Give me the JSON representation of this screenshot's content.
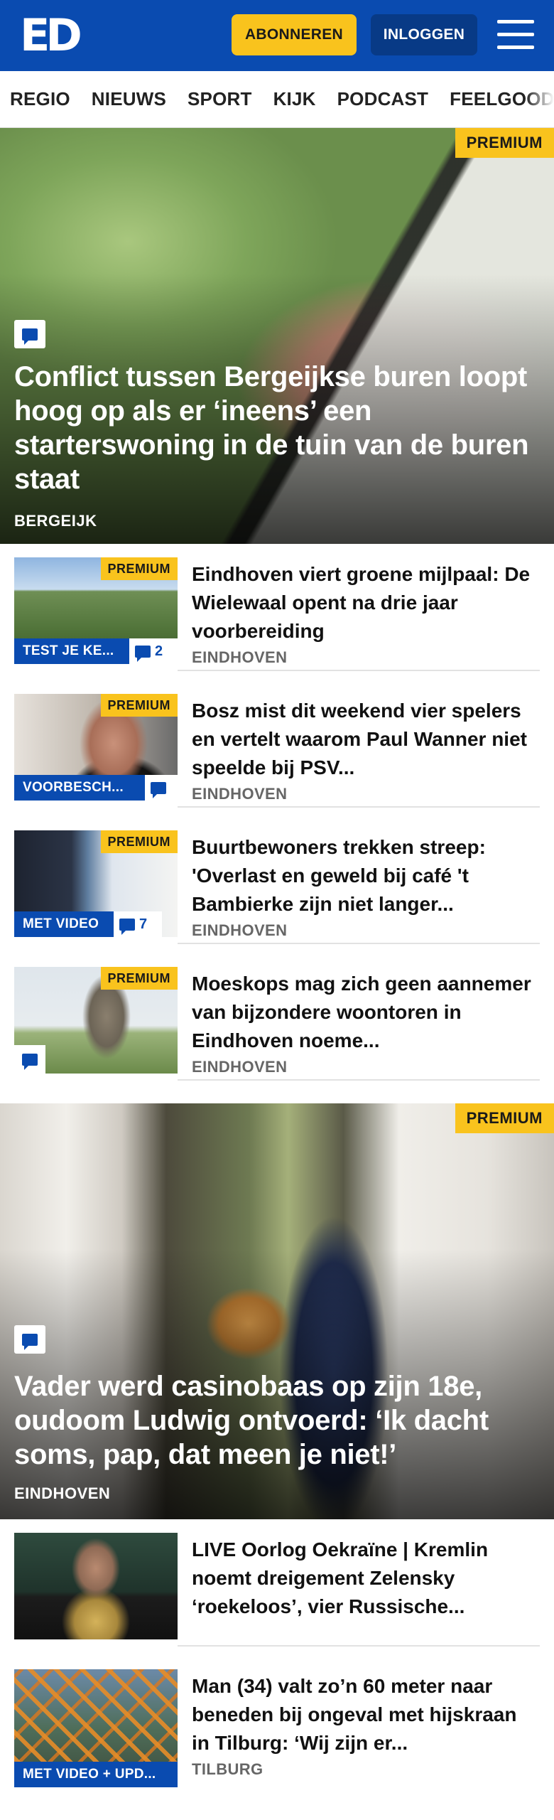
{
  "header": {
    "logo": "ED",
    "subscribe_label": "ABONNEREN",
    "login_label": "INLOGGEN"
  },
  "nav": {
    "items": [
      "REGIO",
      "NIEUWS",
      "SPORT",
      "KIJK",
      "PODCAST",
      "FEELGOOD"
    ]
  },
  "colors": {
    "brand_blue": "#0a4bb0",
    "premium_yellow": "#f9c31d"
  },
  "hero1": {
    "badge": "PREMIUM",
    "title": "Conflict tussen Bergeijkse buren loopt hoog op als er ‘ineens’ een starterswoning in de tuin van de buren staat",
    "location": "BERGEIJK",
    "icon": "comment-icon"
  },
  "articles": [
    {
      "badge": "PREMIUM",
      "label": "TEST JE KE...",
      "comments": "2",
      "title": "Eindhoven viert groene mijlpaal: De Wielewaal opent na drie jaar voorbereiding",
      "location": "EINDHOVEN"
    },
    {
      "badge": "PREMIUM",
      "label": "VOORBESCH...",
      "comments": "",
      "title": "Bosz mist dit weekend vier spelers en vertelt waarom Paul Wanner niet speelde bij PSV...",
      "location": "EINDHOVEN"
    },
    {
      "badge": "PREMIUM",
      "label": "MET VIDEO",
      "comments": "7",
      "title": "Buurtbewoners trekken streep: 'Overlast en geweld bij café 't Bambierke zijn niet langer...",
      "location": "EINDHOVEN"
    },
    {
      "badge": "PREMIUM",
      "label": "",
      "comments": "",
      "title": "Moeskops mag zich geen aannemer van bijzondere woontoren in Eindhoven noeme...",
      "location": "EINDHOVEN"
    }
  ],
  "hero2": {
    "badge": "PREMIUM",
    "title": "Vader werd casinobaas op zijn 18e, oudoom Ludwig ontvoerd: ‘Ik dacht soms, pap, dat meen je niet!’",
    "location": "EINDHOVEN",
    "icon": "comment-icon"
  },
  "articles2": [
    {
      "label": "",
      "title": "LIVE Oorlog Oekraïne | Kremlin noemt dreigement Zelensky ‘roekeloos’, vier Russische...",
      "location": ""
    },
    {
      "label": "MET VIDEO + UPD...",
      "title": "Man (34) valt zo’n 60 meter naar beneden bij ongeval met hijskraan in Tilburg: ‘Wij zijn er...",
      "location": "TILBURG"
    }
  ]
}
